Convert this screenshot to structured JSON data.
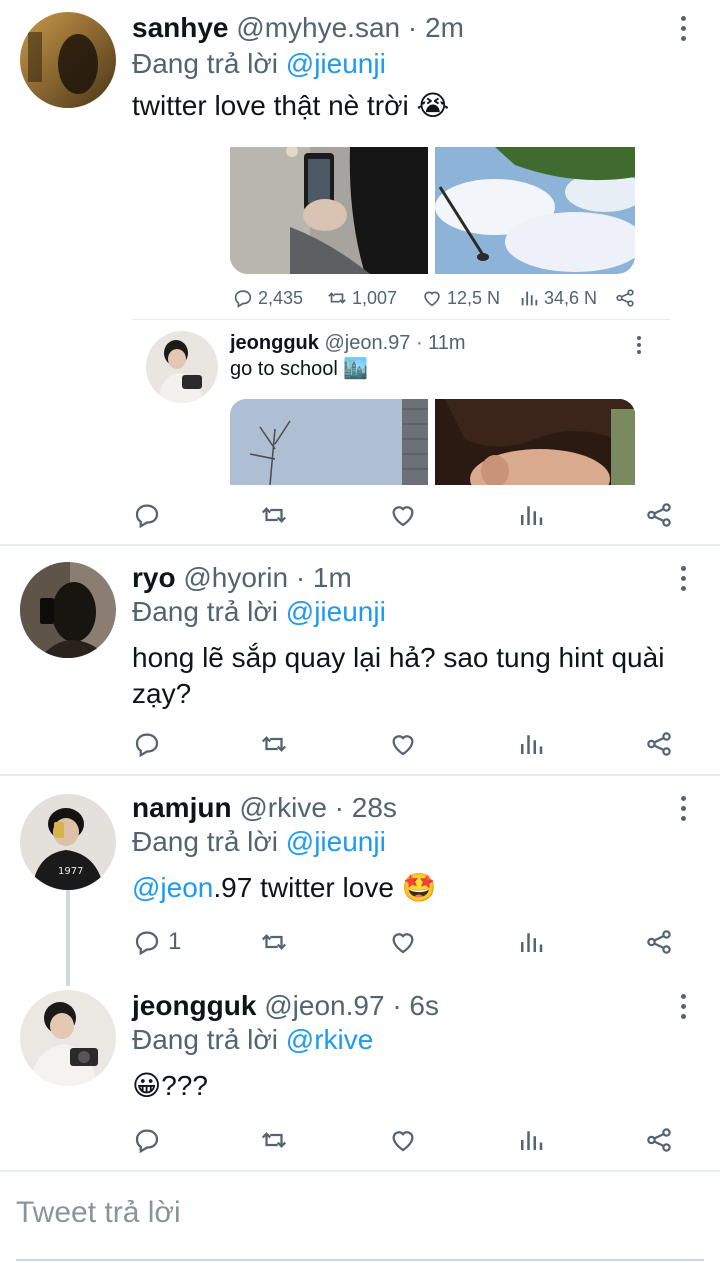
{
  "tweets": [
    {
      "name": "sanhye",
      "handle": "@myhye.san",
      "time": "· 2m",
      "reply_prefix": "Đang trả lời",
      "reply_to": "@jieunji",
      "text": "twitter love thật nè trời 😭",
      "quoted": {
        "stats": {
          "replies": "2,435",
          "retweets": "1,007",
          "likes": "12,5 N",
          "views": "34,6 N"
        },
        "reply": {
          "name": "jeongguk",
          "handle": "@jeon.97",
          "time": "· 11m",
          "text": "go to school 🏙️"
        }
      }
    },
    {
      "name": "ryo",
      "handle": "@hyorin",
      "time": "· 1m",
      "reply_prefix": "Đang trả lời",
      "reply_to": "@jieunji",
      "text_line1": "hong lẽ sắp quay lại hả? sao tung hint quài",
      "text_line2": "zạy?"
    },
    {
      "name": "namjun",
      "handle": "@rkive",
      "time": "· 28s",
      "reply_prefix": "Đang trả lời",
      "reply_to": "@jieunji",
      "text_mention": "@jeon",
      "text_rest": ".97 twitter love 🤩",
      "reply_count": "1"
    },
    {
      "name": "jeongguk",
      "handle": "@jeon.97",
      "time": "· 6s",
      "reply_prefix": "Đang trả lời",
      "reply_to": "@rkive",
      "text": "😀???"
    }
  ],
  "composer": {
    "placeholder": "Tweet trả lời"
  },
  "icons": [
    "reply-icon",
    "retweet-icon",
    "like-icon",
    "views-icon",
    "share-icon",
    "more-icon"
  ],
  "colors": {
    "accent": "#1d9bf0",
    "muted": "#536471",
    "divider": "#e6ecf0"
  }
}
